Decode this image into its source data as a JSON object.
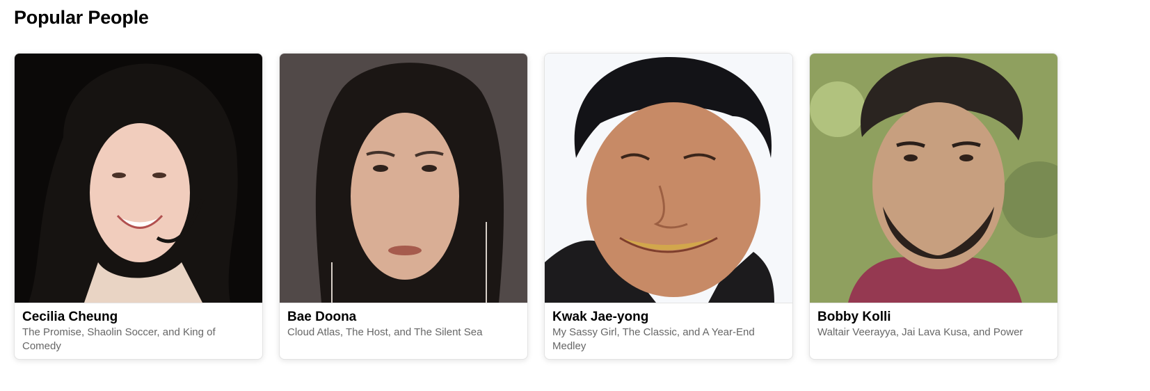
{
  "section": {
    "title": "Popular People"
  },
  "people": [
    {
      "name": "Cecilia Cheung",
      "known_for": "The Promise, Shaolin Soccer, and King of Comedy"
    },
    {
      "name": "Bae Doona",
      "known_for": "Cloud Atlas, The Host, and The Silent Sea"
    },
    {
      "name": "Kwak Jae-yong",
      "known_for": "My Sassy Girl, The Classic, and A Year-End Medley"
    },
    {
      "name": "Bobby Kolli",
      "known_for": "Waltair Veerayya, Jai Lava Kusa, and Power"
    }
  ],
  "colors": {
    "card_border": "#e3e3e3",
    "secondary_text": "#666666"
  }
}
